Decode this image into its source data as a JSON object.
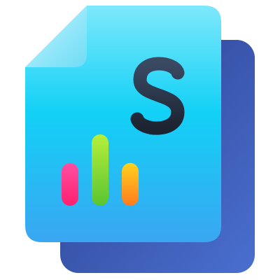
{
  "icon": {
    "name": "financial-report-icon",
    "symbol": "$",
    "colors": {
      "front_page_top": "#7ee8fb",
      "front_page_mid": "#12d1f6",
      "front_page_bottom": "#3aa6f2",
      "fold_light": "#c2f6ff",
      "fold_shadow": "#6fdcf5",
      "back_page_top": "#2a3f8c",
      "back_page_bottom": "#4a6fd0",
      "dollar_top": "#3a4a63",
      "dollar_bottom": "#1c2331"
    },
    "bars": [
      {
        "name": "pink-bar",
        "level": 0.6,
        "color_top": "#ff4fa3",
        "color_bottom": "#ff1f6e"
      },
      {
        "name": "green-bar",
        "level": 1.0,
        "color_top": "#b6ef3a",
        "color_bottom": "#5ac531"
      },
      {
        "name": "orange-bar",
        "level": 0.6,
        "color_top": "#ffd21f",
        "color_bottom": "#ff7b1f"
      }
    ]
  }
}
